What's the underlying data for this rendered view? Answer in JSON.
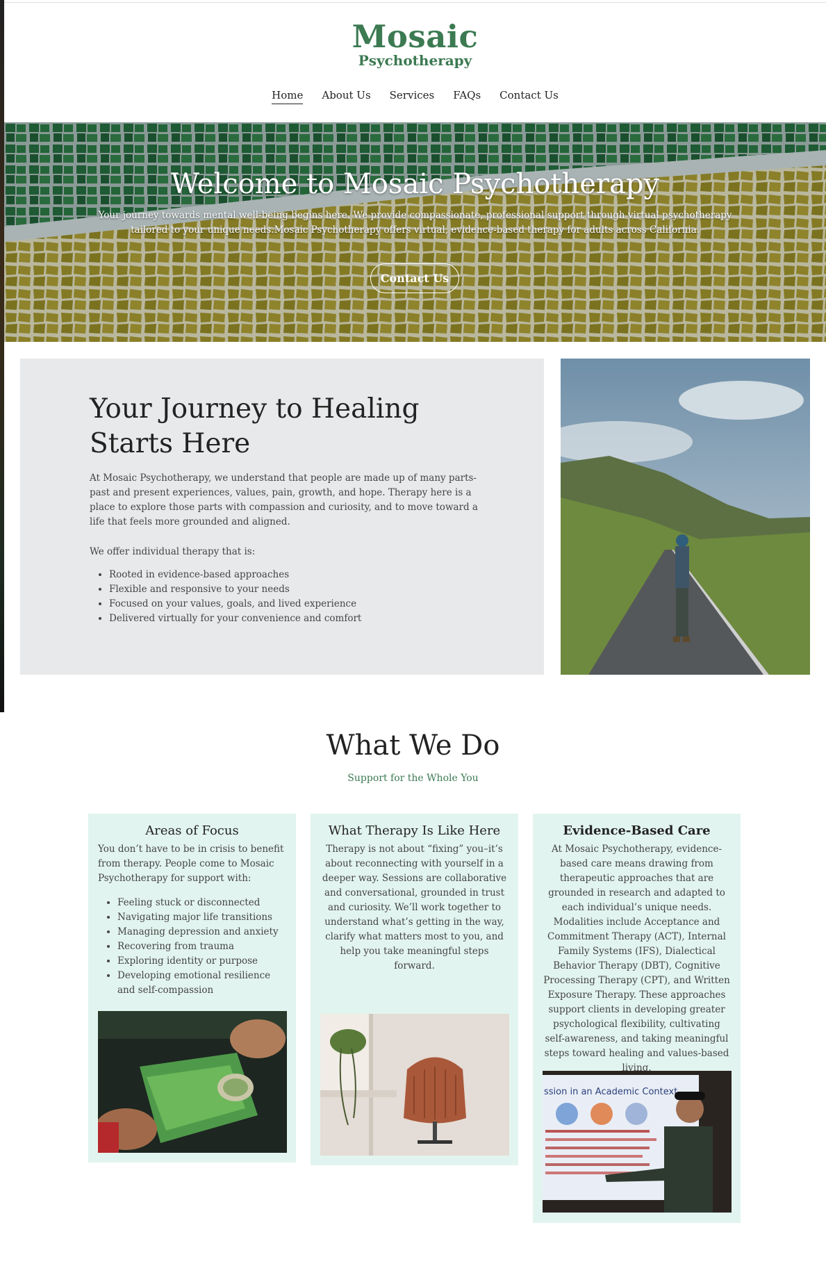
{
  "brand": {
    "line1": "Mosaic",
    "line2": "Psychotherapy",
    "color": "#3c7a52"
  },
  "nav": {
    "items": [
      "Home",
      "About Us",
      "Services",
      "FAQs",
      "Contact Us"
    ],
    "active": "Home"
  },
  "hero": {
    "title": "Welcome to Mosaic Psychotherapy",
    "text": "Your journey towards mental well-being begins here. We provide compassionate, professional support through virtual psychotherapy tailored to your unique needs.Mosaic Psychotherapy offers virtual, evidence-based therapy for adults across California.",
    "button": "Contact Us"
  },
  "journey": {
    "title": "Your Journey to Healing Starts Here",
    "paragraph": "At Mosaic Psychotherapy, we understand that people are made up of many parts-past and present experiences, values, pain, growth, and hope. Therapy here is a place to explore those parts with compassion and curiosity, and to move toward a life that feels more grounded and aligned.",
    "offer": "We offer individual therapy that is:",
    "list": [
      "Rooted in evidence-based approaches",
      "Flexible and responsive to your needs",
      "Focused on your values, goals, and lived experience",
      "Delivered virtually for your convenience and comfort"
    ]
  },
  "what_we_do": {
    "title": "What We Do",
    "subtitle": "Support for the Whole You",
    "cards": [
      {
        "title": "Areas of Focus",
        "text": "You don’t have to be in crisis to benefit from therapy. People come to Mosaic Psychotherapy for support with:",
        "list": [
          "Feeling stuck or disconnected",
          "Navigating major life transitions",
          "Managing depression and anxiety",
          "Recovering from trauma",
          "Exploring identity or purpose",
          "Developing emotional resilience and self-compassion"
        ]
      },
      {
        "title": "What Therapy Is Like Here",
        "text": "Therapy is not about “fixing” you–it’s about reconnecting with yourself in a deeper way. Sessions are collaborative and conversational, grounded in trust and curiosity. We’ll work together to understand what’s getting in the way, clarify what matters most to you, and help you take meaningful steps forward."
      },
      {
        "title": "Evidence-Based Care",
        "text": "At Mosaic Psychotherapy, evidence-based care means drawing from therapeutic approaches that are grounded in research and adapted to each individual’s unique needs. Modalities include Acceptance and Commitment Therapy (ACT), Internal Family Systems (IFS), Dialectical Behavior Therapy (DBT), Cognitive Processing Therapy (CPT), and Written Exposure Therapy. These approaches support clients in developing greater psychological flexibility, cultivating self-awareness, and taking meaningful steps toward healing and values-based living."
      }
    ],
    "slide_title": "ssion in an Academic Context"
  }
}
